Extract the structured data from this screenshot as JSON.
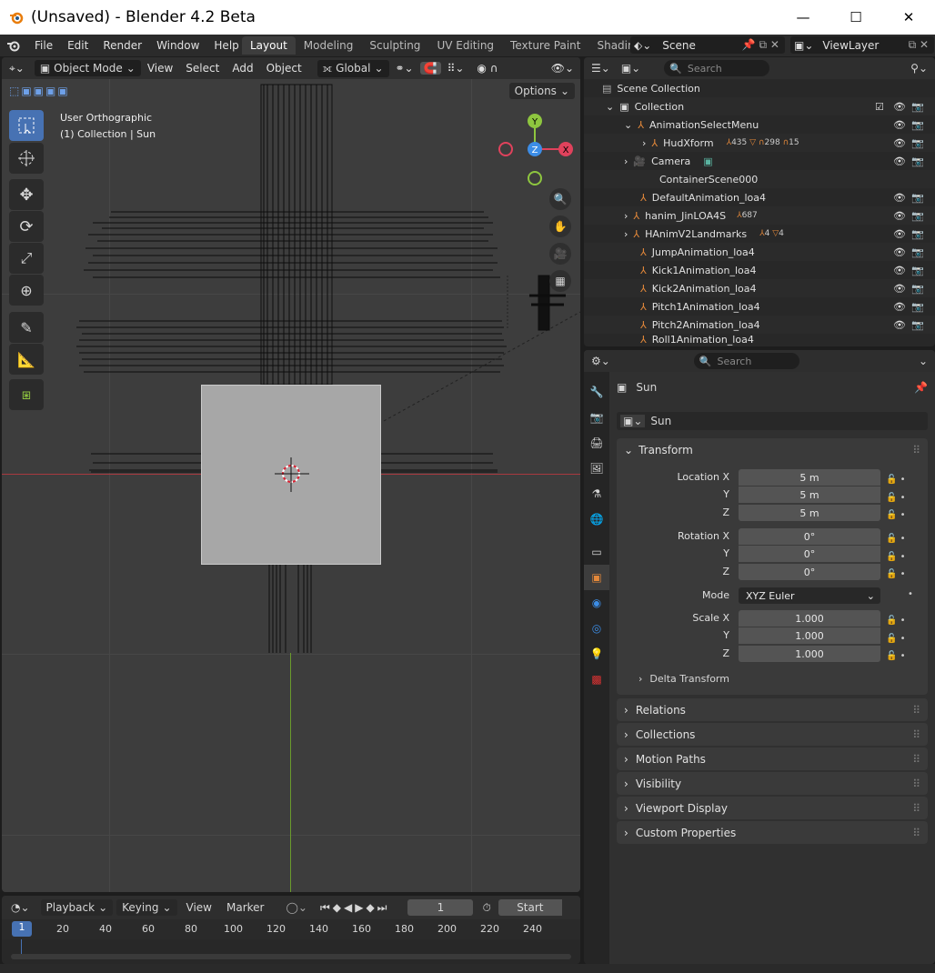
{
  "window": {
    "title": "(Unsaved) - Blender 4.2 Beta",
    "minimize": "—",
    "maximize": "☐",
    "close": "✕"
  },
  "menu": [
    "File",
    "Edit",
    "Render",
    "Window",
    "Help"
  ],
  "workspaces": [
    "Layout",
    "Modeling",
    "Sculpting",
    "UV Editing",
    "Texture Paint",
    "Shading"
  ],
  "scene": {
    "name": "Scene",
    "view_layer": "ViewLayer"
  },
  "viewport": {
    "mode": "Object Mode",
    "menus": [
      "View",
      "Select",
      "Add",
      "Object"
    ],
    "orientation": "Global",
    "options": "Options",
    "overlay_title": "User Orthographic",
    "overlay_sub": "(1) Collection | Sun",
    "gizmo": {
      "y": "Y",
      "z": "Z",
      "x": "X"
    }
  },
  "outliner": {
    "search_placeholder": "Search",
    "rows": [
      {
        "label": "Scene Collection"
      },
      {
        "label": "Collection"
      },
      {
        "label": "AnimationSelectMenu"
      },
      {
        "label": "HudXform",
        "extra": [
          "435",
          "298",
          "15"
        ]
      },
      {
        "label": "Camera"
      },
      {
        "label": "ContainerScene000"
      },
      {
        "label": "DefaultAnimation_loa4"
      },
      {
        "label": "hanim_JinLOA4S",
        "extra": [
          "687"
        ]
      },
      {
        "label": "HAnimV2Landmarks",
        "extra": [
          "4",
          "4"
        ]
      },
      {
        "label": "JumpAnimation_loa4"
      },
      {
        "label": "Kick1Animation_loa4"
      },
      {
        "label": "Kick2Animation_loa4"
      },
      {
        "label": "Pitch1Animation_loa4"
      },
      {
        "label": "Pitch2Animation_loa4"
      },
      {
        "label": "Roll1Animation_loa4"
      }
    ]
  },
  "properties": {
    "search_placeholder": "Search",
    "object_name": "Sun",
    "data_name": "Sun",
    "transform": {
      "header": "Transform",
      "location_label": "Location X",
      "location": [
        "5 m",
        "5 m",
        "5 m"
      ],
      "rotation_label": "Rotation X",
      "rotation": [
        "0°",
        "0°",
        "0°"
      ],
      "mode_label": "Mode",
      "mode": "XYZ Euler",
      "scale_label": "Scale X",
      "scale": [
        "1.000",
        "1.000",
        "1.000"
      ],
      "y": "Y",
      "z": "Z",
      "delta": "Delta Transform"
    },
    "panels": [
      "Relations",
      "Collections",
      "Motion Paths",
      "Visibility",
      "Viewport Display",
      "Custom Properties"
    ]
  },
  "timeline": {
    "menus": [
      "Playback",
      "Keying",
      "View",
      "Marker"
    ],
    "current_frame": "1",
    "start": "Start",
    "frame_marker": "1",
    "ticks": [
      "20",
      "40",
      "60",
      "80",
      "100",
      "120",
      "140",
      "160",
      "180",
      "200",
      "220",
      "240"
    ]
  },
  "colors": {
    "accent": "#4772b3",
    "object_orange": "#e3883a",
    "x_axis": "#e0425c",
    "y_axis": "#8ec63f",
    "z_axis": "#3c8de6"
  }
}
